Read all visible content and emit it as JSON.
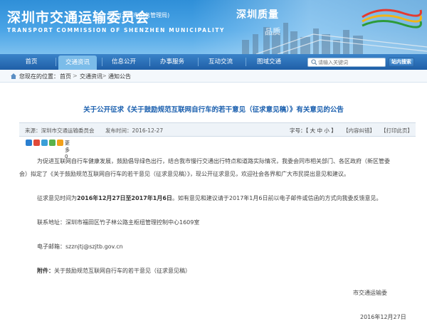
{
  "header": {
    "title": "深圳市交通运输委员会",
    "subtitle": "(深圳市港务管理局)",
    "english": "TRANSPORT COMMISSION OF SHENZHEN MUNICIPALITY",
    "slogan": "深圳质量",
    "slogan2": "品质"
  },
  "nav": {
    "items": [
      "首页",
      "交通资讯",
      "信息公开",
      "办事服务",
      "互动交流",
      "图域交通"
    ],
    "active_index": 1,
    "search_placeholder": "请输入关键词",
    "search_button": "站内搜索"
  },
  "breadcrumb": {
    "prefix": "您现在的位置：",
    "items": [
      "首页",
      "交通资讯",
      "通知公告"
    ],
    "sep": ">"
  },
  "article": {
    "title": "关于公开征求《关于鼓励规范互联网自行车的若干意见（征求意见稿）》有关意见的公告",
    "source": "来源：深圳市交通运输委员会",
    "date": "发布时间：2016-12-27",
    "fontsize_label": "字号：【 大  中  小 】",
    "correction": "【内容纠错】",
    "print": "【打印此页】",
    "share_more": "更多 0",
    "para1_line1": "为促进互联网自行车健康发展，鼓励倡导绿色出行，结合我市慢行交通出行特点和道路实际情况，我委会同市相关部门、各区政府（新区管委",
    "para1_line2": "会）拟定了《关于鼓励规范互联网自行车的若干意见（征求意见稿）》，现公开征求意见，欢迎社会各界和广大市民提出意见和建议。",
    "para2_pre": "征求意见时间为",
    "para2_bold": "2016年12月27日至2017年1月6日",
    "para2_post": "。如有意见和建议请于2017年1月6日前以电子邮件或信函的方式向我委反馈意见。",
    "address": "联系地址：深圳市福田区竹子林公路主枢纽管理控制中心1609室",
    "email": "电子邮箱：szznjtj@szjtb.gov.cn",
    "attachment_label": "附件：",
    "attachment_link": "关于鼓励规范互联网自行车的若干意见（征求意见稿）",
    "signature": "市交通运输委",
    "sign_date": "2016年12月27日"
  },
  "colors": {
    "nav_bg": "#1f5fa7",
    "title": "#1a5fae",
    "header_bg": "#3a96dc"
  }
}
